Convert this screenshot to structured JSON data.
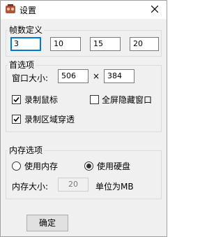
{
  "window": {
    "title": "设置",
    "icon": "app-icon"
  },
  "frame_group": {
    "label": "帧数定义",
    "values": [
      "3",
      "10",
      "15",
      "20"
    ]
  },
  "options_group": {
    "label": "首选项",
    "window_size_label": "窗口大小:",
    "width": "506",
    "times": "×",
    "height": "384",
    "record_mouse": {
      "label": "录制鼠标",
      "checked": true
    },
    "fullscreen_hide": {
      "label": "全屏隐藏窗口",
      "checked": false
    },
    "record_transparent": {
      "label": "录制区域穿透",
      "checked": true
    }
  },
  "memory_group": {
    "label": "内存选项",
    "use_memory": {
      "label": "使用内存",
      "selected": false
    },
    "use_disk": {
      "label": "使用硬盘",
      "selected": true
    },
    "memory_size_label": "内存大小:",
    "memory_size": "20",
    "unit_label": "单位为MB"
  },
  "footer": {
    "ok_label": "确定"
  }
}
